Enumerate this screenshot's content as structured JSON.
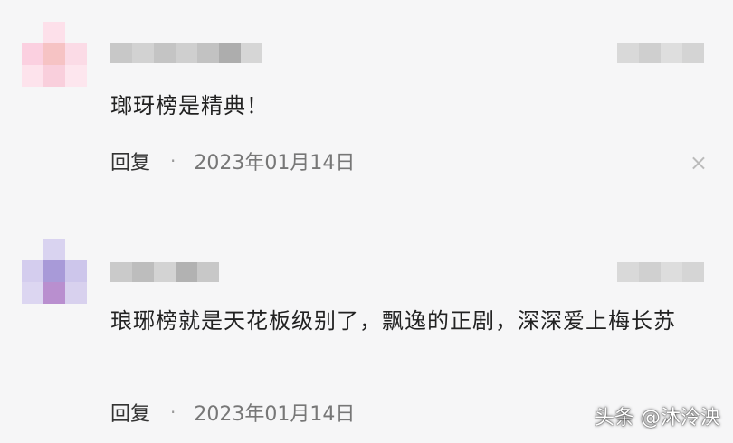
{
  "comments": [
    {
      "text": "瑯玡榜是精典！",
      "reply_label": "回复",
      "separator": "·",
      "date": "2023年01月14日",
      "close_glyph": "×",
      "avatar_color": "#f5b8cf"
    },
    {
      "text": "琅琊榜就是天花板级别了，飘逸的正剧，深深爱上梅长苏",
      "reply_label": "回复",
      "separator": "·",
      "date": "2023年01月14日",
      "avatar_color": "#a89ad8"
    }
  ],
  "watermark": "头条 @沐泠泱"
}
